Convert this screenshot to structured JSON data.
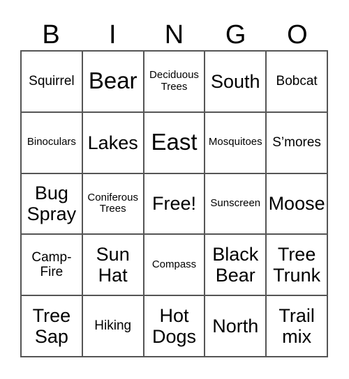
{
  "header": [
    "B",
    "I",
    "N",
    "G",
    "O"
  ],
  "cells": [
    {
      "text": "Squirrel",
      "size": "s3"
    },
    {
      "text": "Bear",
      "size": "s5"
    },
    {
      "text": "Deciduous Trees",
      "size": "s1"
    },
    {
      "text": "South",
      "size": "s4"
    },
    {
      "text": "Bobcat",
      "size": "s3"
    },
    {
      "text": "Binoculars",
      "size": "s1"
    },
    {
      "text": "Lakes",
      "size": "s4"
    },
    {
      "text": "East",
      "size": "s5"
    },
    {
      "text": "Mosquitoes",
      "size": "s1"
    },
    {
      "text": "S’mores",
      "size": "s3"
    },
    {
      "text": "Bug Spray",
      "size": "s4"
    },
    {
      "text": "Coniferous Trees",
      "size": "s1"
    },
    {
      "text": "Free!",
      "size": "s4"
    },
    {
      "text": "Sunscreen",
      "size": "s1"
    },
    {
      "text": "Moose",
      "size": "s4"
    },
    {
      "text": "Camp-Fire",
      "size": "s3"
    },
    {
      "text": "Sun Hat",
      "size": "s4"
    },
    {
      "text": "Compass",
      "size": "s2"
    },
    {
      "text": "Black Bear",
      "size": "s4"
    },
    {
      "text": "Tree Trunk",
      "size": "s4"
    },
    {
      "text": "Tree Sap",
      "size": "s4"
    },
    {
      "text": "Hiking",
      "size": "s3"
    },
    {
      "text": "Hot Dogs",
      "size": "s4"
    },
    {
      "text": "North",
      "size": "s4"
    },
    {
      "text": "Trail mix",
      "size": "s4"
    }
  ]
}
